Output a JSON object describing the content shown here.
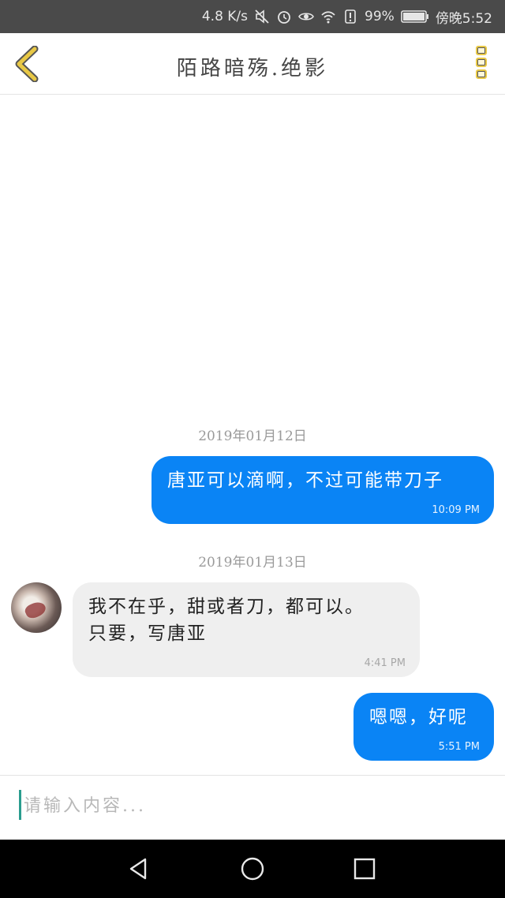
{
  "status_bar": {
    "net_speed": "4.8 K/s",
    "battery_percent": "99%",
    "time": "傍晚5:52",
    "icons": [
      "mute-icon",
      "alarm-icon",
      "eye-icon",
      "wifi-icon",
      "alert-icon",
      "battery-icon"
    ]
  },
  "header": {
    "title": "陌路暗殇.绝影",
    "back_icon": "chevron-left-icon",
    "menu_icon": "more-vertical-icon",
    "accent": "#e8c845"
  },
  "messages": [
    {
      "type": "date",
      "text": "2019年01月12日"
    },
    {
      "type": "outgoing",
      "text": "唐亚可以滴啊，不过可能带刀子",
      "time": "10:09 PM"
    },
    {
      "type": "date",
      "text": "2019年01月13日"
    },
    {
      "type": "incoming",
      "text": "我不在乎，甜或者刀，都可以。\n只要，写唐亚",
      "time": "4:41 PM"
    },
    {
      "type": "outgoing",
      "text": "嗯嗯，好呢",
      "time": "5:51 PM"
    }
  ],
  "input": {
    "placeholder": "请输入内容..."
  },
  "colors": {
    "outgoing_bubble": "#0a84f5",
    "incoming_bubble": "#efefef",
    "status_bar_bg": "#4a4a4a",
    "nav_bar_bg": "#000000"
  }
}
